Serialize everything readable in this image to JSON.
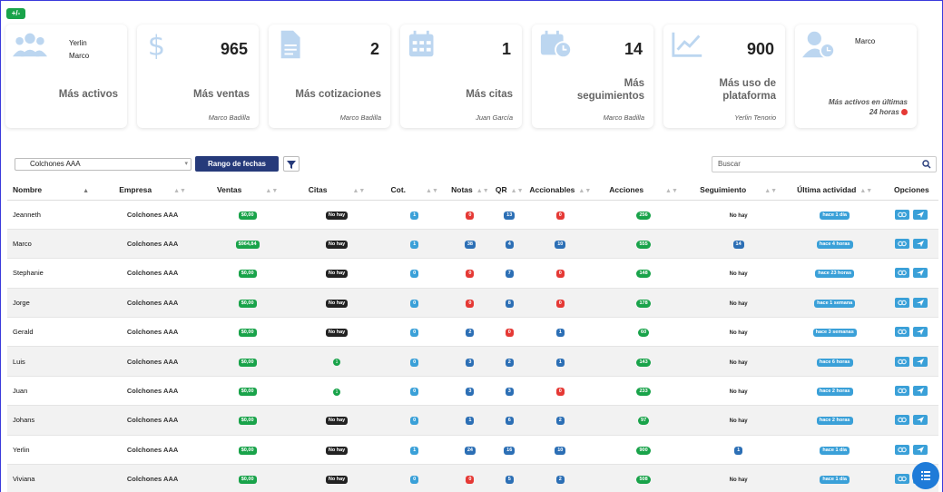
{
  "toggle": "+/-",
  "cards": [
    {
      "id": "activos",
      "count": "",
      "label": "Más activos",
      "who": "",
      "names": [
        "Yerlin",
        "Marco"
      ]
    },
    {
      "id": "ventas",
      "count": "965",
      "label": "Más ventas",
      "who": "Marco Badilla"
    },
    {
      "id": "cotizaciones",
      "count": "2",
      "label": "Más cotizaciones",
      "who": "Marco Badilla"
    },
    {
      "id": "citas",
      "count": "1",
      "label": "Más citas",
      "who": "Juan García"
    },
    {
      "id": "seguimientos",
      "count": "14",
      "label": "Más seguimientos",
      "who": "Marco Badilla"
    },
    {
      "id": "plataforma",
      "count": "900",
      "label": "Más uso de plataforma",
      "who": "Yerlin Tenorio"
    },
    {
      "id": "ultimas24",
      "name": "Marco",
      "foot": "Más activos en últimas 24 horas"
    }
  ],
  "filters": {
    "company": "Colchones AAA",
    "date_range": "Rango de fechas",
    "search_placeholder": "Buscar"
  },
  "columns": [
    "Nombre",
    "Empresa",
    "Ventas",
    "Citas",
    "Cot.",
    "Notas",
    "QR",
    "Accionables",
    "Acciones",
    "Seguimiento",
    "Última actividad",
    "Opciones"
  ],
  "rows": [
    {
      "nombre": "Jeanneth",
      "empresa": "Colchones AAA",
      "ventas": "$0,00",
      "citas": "No hay",
      "cot": "1",
      "notas": "0",
      "qr": "13",
      "accionables": "0",
      "acciones": "256",
      "seguimiento": "No hay",
      "actividad": "hace 1 día"
    },
    {
      "nombre": "Marco",
      "empresa": "Colchones AAA",
      "ventas": "$964,84",
      "citas": "No hay",
      "cot": "1",
      "notas": "38",
      "qr": "4",
      "accionables": "10",
      "acciones": "555",
      "seguimiento": "14",
      "actividad": "hace 4 horas"
    },
    {
      "nombre": "Stephanie",
      "empresa": "Colchones AAA",
      "ventas": "$0,00",
      "citas": "No hay",
      "cot": "0",
      "notas": "0",
      "qr": "7",
      "accionables": "0",
      "acciones": "148",
      "seguimiento": "No hay",
      "actividad": "hace 23 horas"
    },
    {
      "nombre": "Jorge",
      "empresa": "Colchones AAA",
      "ventas": "$0,00",
      "citas": "No hay",
      "cot": "0",
      "notas": "0",
      "qr": "8",
      "accionables": "0",
      "acciones": "178",
      "seguimiento": "No hay",
      "actividad": "hace 1 semana"
    },
    {
      "nombre": "Gerald",
      "empresa": "Colchones AAA",
      "ventas": "$0,00",
      "citas": "No hay",
      "cot": "0",
      "notas": "2",
      "qr": "0",
      "accionables": "1",
      "acciones": "60",
      "seguimiento": "No hay",
      "actividad": "hace 3 semanas"
    },
    {
      "nombre": "Luis",
      "empresa": "Colchones AAA",
      "ventas": "$0,00",
      "citas": "1",
      "cot": "0",
      "notas": "3",
      "qr": "2",
      "accionables": "1",
      "acciones": "143",
      "seguimiento": "No hay",
      "actividad": "hace 6 horas"
    },
    {
      "nombre": "Juan",
      "empresa": "Colchones AAA",
      "ventas": "$0,00",
      "citas": "1",
      "cot": "0",
      "notas": "3",
      "qr": "3",
      "accionables": "0",
      "acciones": "233",
      "seguimiento": "No hay",
      "actividad": "hace 2 horas"
    },
    {
      "nombre": "Johans",
      "empresa": "Colchones AAA",
      "ventas": "$0,00",
      "citas": "No hay",
      "cot": "0",
      "notas": "1",
      "qr": "6",
      "accionables": "2",
      "acciones": "97",
      "seguimiento": "No hay",
      "actividad": "hace 2 horas"
    },
    {
      "nombre": "Yerlin",
      "empresa": "Colchones AAA",
      "ventas": "$0,00",
      "citas": "No hay",
      "cot": "1",
      "notas": "24",
      "qr": "16",
      "accionables": "10",
      "acciones": "900",
      "seguimiento": "1",
      "actividad": "hace 1 día"
    },
    {
      "nombre": "Viviana",
      "empresa": "Colchones AAA",
      "ventas": "$0,00",
      "citas": "No hay",
      "cot": "0",
      "notas": "0",
      "qr": "5",
      "accionables": "2",
      "acciones": "508",
      "seguimiento": "No hay",
      "actividad": "hace 1 día"
    }
  ],
  "icons": {
    "card_icons": [
      "users-icon",
      "dollar-icon",
      "document-icon",
      "calendar-icon",
      "calendar-clock-icon",
      "chart-line-icon",
      "user-clock-icon"
    ],
    "row_options": [
      "link-icon",
      "send-icon"
    ],
    "fab": "list-icon"
  },
  "colors": {
    "accent": "#3aa0d8",
    "card_icon": "#bcd6f0",
    "dark_button": "#263a7a",
    "green": "#19a34a",
    "red": "#e53935"
  }
}
